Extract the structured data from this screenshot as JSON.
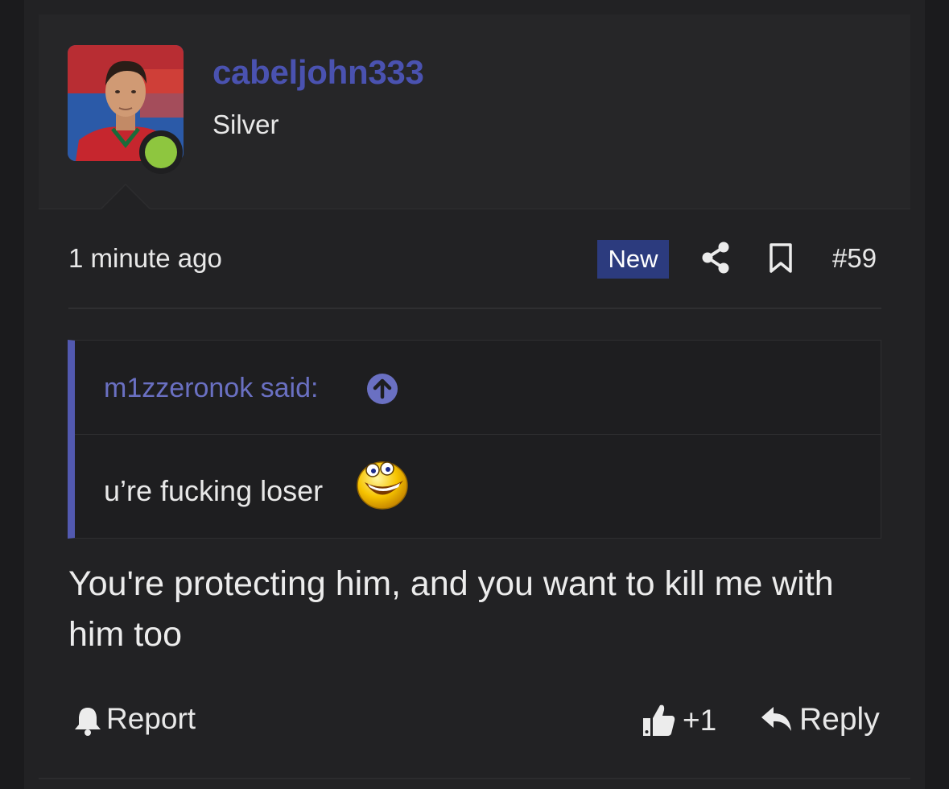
{
  "user": {
    "username": "cabeljohn333",
    "title": "Silver",
    "status": "online"
  },
  "meta": {
    "timestamp": "1 minute ago",
    "badge": "New",
    "post_number": "#59"
  },
  "quote": {
    "author_label": "m1zzeronok said:",
    "text": "u’re fucking loser"
  },
  "message": "You're protecting him, and you want to kill me with him too",
  "actions": {
    "report_label": "Report",
    "like_count": "+1",
    "reply_label": "Reply"
  },
  "colors": {
    "accent": "#4a52b0",
    "badge_bg": "#2c3b7e",
    "online": "#8ec63f",
    "quote_border": "#5259b0"
  }
}
